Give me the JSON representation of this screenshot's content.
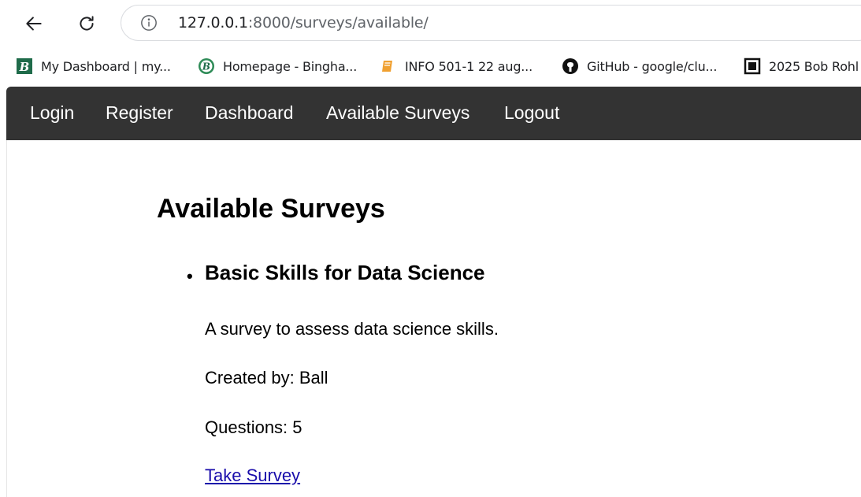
{
  "browser": {
    "url_host": "127.0.0.1",
    "url_path": ":8000/surveys/available/",
    "bookmarks": [
      {
        "label": "My Dashboard | my...",
        "icon": "b-logo-icon"
      },
      {
        "label": "Homepage - Bingha...",
        "icon": "b-logo-round-icon"
      },
      {
        "label": "INFO 501-1 22 aug...",
        "icon": "book-icon"
      },
      {
        "label": "GitHub - google/clu...",
        "icon": "github-icon"
      },
      {
        "label": "2025 Bob Rohl",
        "icon": "square-icon"
      }
    ]
  },
  "nav": {
    "items": [
      "Login",
      "Register",
      "Dashboard",
      "Available Surveys",
      "Logout"
    ]
  },
  "page": {
    "title": "Available Surveys",
    "survey": {
      "title": "Basic Skills for Data Science",
      "description": "A survey to assess data science skills.",
      "created_by": "Created by: Ball",
      "questions": "Questions: 5",
      "link": "Take Survey"
    }
  },
  "colors": {
    "nav_bg": "#333333",
    "link": "#1a0dab",
    "bookmark_b": "#1f6b4a",
    "bookmark_book": "#f0a030"
  }
}
